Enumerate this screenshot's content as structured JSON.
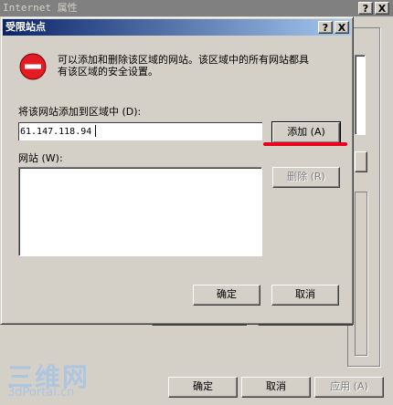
{
  "back_window": {
    "title": "Internet 属性",
    "help_btn": "?",
    "close_btn": "X",
    "buttons": {
      "ok": "确定",
      "cancel": "取消",
      "apply": "应用 (A)"
    }
  },
  "dialog": {
    "title": "受限站点",
    "help_btn": "?",
    "close_btn": "X",
    "description_line1": "可以添加和删除该区域的网站。该区域中的所有网站都具",
    "description_line2": "有该区域的安全设置。",
    "add_label": "将该网站添加到区域中 (D):",
    "site_input": {
      "value": "61.147.118.94",
      "placeholder": ""
    },
    "add_button": "添加 (A)",
    "websites_label": "网站 (W):",
    "websites": [],
    "remove_button": "删除 (R)",
    "ok_button": "确定",
    "cancel_button": "取消"
  },
  "watermark": {
    "main": "三维网",
    "sub": "3dPortal.cn"
  },
  "icons": {
    "warning": "stop-icon",
    "help": "question-icon",
    "close": "close-icon"
  },
  "colors": {
    "titlebar_active_start": "#0a246a",
    "titlebar_active_end": "#a6caf0",
    "titlebar_inactive": "#808080",
    "face": "#d4d0c8",
    "stop_red": "#e31b23",
    "highlight_underline": "#e8001c",
    "watermark": "#a8c4e4"
  }
}
